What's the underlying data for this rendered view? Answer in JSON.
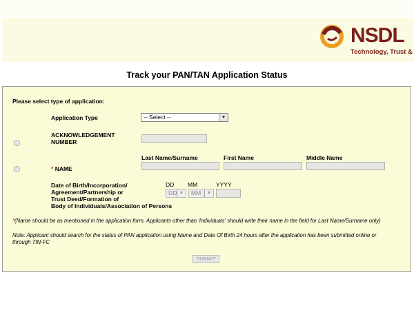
{
  "header": {
    "logo_name": "NSDL",
    "logo_tagline": "Technology, Trust & Reach"
  },
  "page_title": "Track your PAN/TAN Application Status",
  "form": {
    "section_prompt": "Please select type of application:",
    "application_type_label": "Application Type",
    "application_type_value": "-- Select --",
    "ack_label_1": "ACKNOWLEDGEMENT",
    "ack_label_2": "NUMBER",
    "name_required_mark": "*",
    "name_label": "NAME",
    "last_name_header": "Last Name/Surname",
    "first_name_header": "First Name",
    "middle_name_header": "Middle Name",
    "dob_label_lines": [
      "Date of Birth/Incorporation/",
      "Agreement/Partnership or",
      "Trust Deed/Formation of",
      "Body of Individuals/Association of Persons"
    ],
    "dd_header": "DD",
    "mm_header": "MM",
    "yyyy_header": "YYYY",
    "dd_value": "DD",
    "mm_value": "MM",
    "name_note": "*(Name should be as mentioned in the application form. Applicants other than 'Individuals' should write their name in the field for Last Name/Surname only)",
    "info_note_1": "Note: Applicant should search for the status of PAN application using Name and Date Of Birth 24 hours after the application has been submitted online or",
    "info_note_2": "through TIN-FC",
    "submit_label": "SUBMIT"
  },
  "colors": {
    "brand": "#7a1f1a",
    "panel_background": "#fbfbd8",
    "required": "#d21e1e"
  },
  "icons": {
    "logo": "nsdl-logo-icon",
    "dropdown": "chevron-down-icon"
  }
}
